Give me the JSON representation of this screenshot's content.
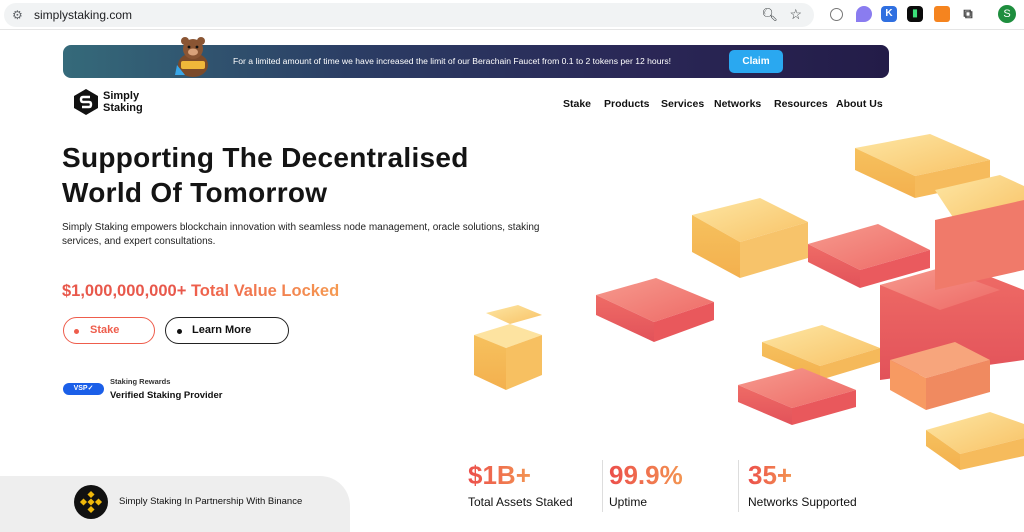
{
  "browser": {
    "url": "simplystaking.com",
    "profile_initial": "S",
    "extension_icons": [
      "copilot-icon",
      "feather-icon",
      "k-icon",
      "terminal-icon",
      "metamask-icon",
      "puzzle-icon"
    ]
  },
  "banner": {
    "text": "For a limited amount of time we have increased the limit of our Berachain Faucet from 0.1 to 2 tokens per 12 hours!",
    "claim_label": "Claim"
  },
  "logo": {
    "line1": "Simply",
    "line2": "Staking"
  },
  "nav": {
    "items": [
      "Stake",
      "Products",
      "Services",
      "Networks",
      "Resources",
      "About Us"
    ]
  },
  "hero": {
    "title_line1": "Supporting The Decentralised",
    "title_line2": "World Of Tomorrow",
    "description": "Simply Staking empowers blockchain innovation with seamless node management, oracle solutions, staking services, and expert consultations.",
    "tvl_amount": "$1,000,000,000+",
    "tvl_suffix": "Total Value Locked",
    "stake_label": "Stake",
    "learn_more_label": "Learn More"
  },
  "verified": {
    "badge": "VSP✓",
    "source": "Staking Rewards",
    "label": "Verified Staking Provider"
  },
  "partner": {
    "text": "Simply Staking In Partnership With Binance"
  },
  "stats": [
    {
      "value": "$1B+",
      "label": "Total Assets Staked"
    },
    {
      "value": "99.9%",
      "label": "Uptime"
    },
    {
      "value": "35+",
      "label": "Networks Supported"
    }
  ],
  "colors": {
    "accent": "#ee5d4c",
    "accent_orange": "#f59a52",
    "claim_blue": "#2aa8f0",
    "badge_blue": "#1b5fe8",
    "cube_yellow": "#fcd27a",
    "cube_red": "#f06a66"
  }
}
